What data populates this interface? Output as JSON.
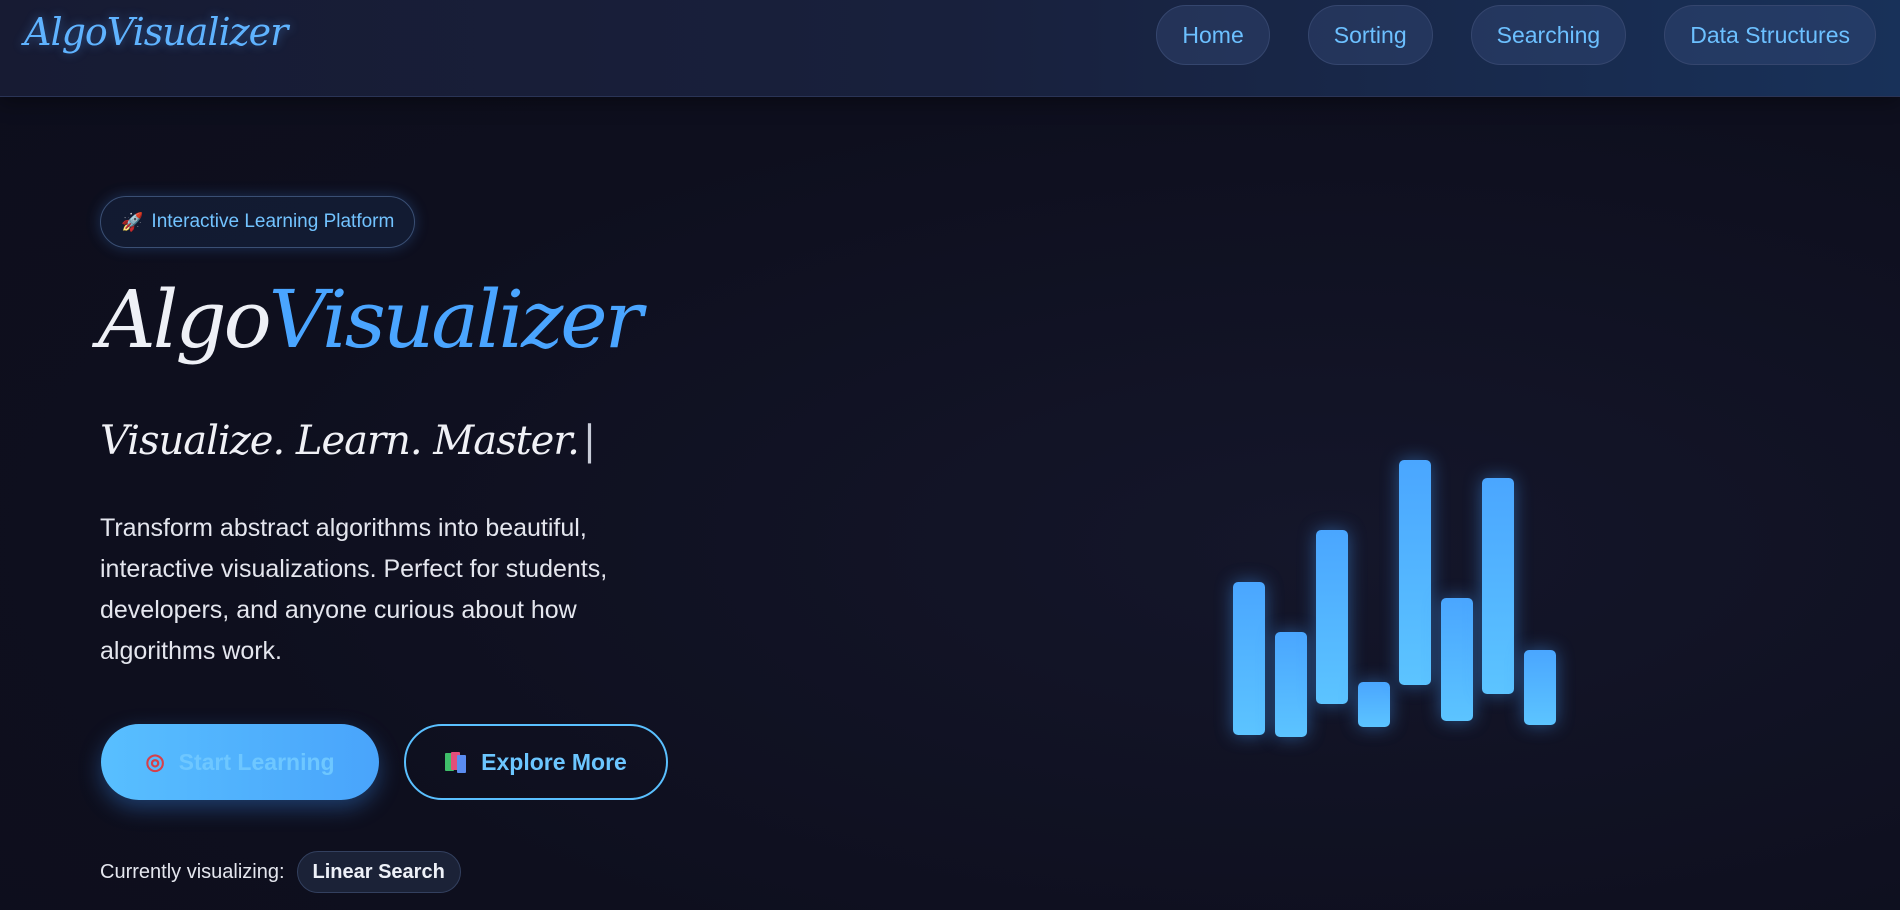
{
  "nav": {
    "logo": "AlgoVisualizer",
    "links": [
      {
        "label": "Home"
      },
      {
        "label": "Sorting"
      },
      {
        "label": "Searching"
      },
      {
        "label": "Data Structures"
      }
    ]
  },
  "hero": {
    "badge_icon": "rocket-icon",
    "badge_text": "Interactive Learning Platform",
    "title_part1": "Algo",
    "title_part2": "Visualizer",
    "tagline": "Visualize. Learn. Master.",
    "tagline_cursor": "|",
    "description": "Transform abstract algorithms into beautiful, interactive visualizations. Perfect for students, developers, and anyone curious about how algorithms work.",
    "primary_button": {
      "icon": "target-icon",
      "label": "Start Learning"
    },
    "secondary_button": {
      "icon": "books-icon",
      "label": "Explore More"
    },
    "currently_label": "Currently visualizing:",
    "current_algorithm": "Linear Search"
  },
  "bar_visualization": {
    "bar_color": "#4aa6ff",
    "relative_heights": [
      0.51,
      0.35,
      0.58,
      0.15,
      0.75,
      0.41,
      0.72,
      0.25
    ]
  },
  "colors": {
    "accent": "#4aa5ff",
    "nav_text": "#6cc0ff",
    "background": "#0f1020"
  }
}
